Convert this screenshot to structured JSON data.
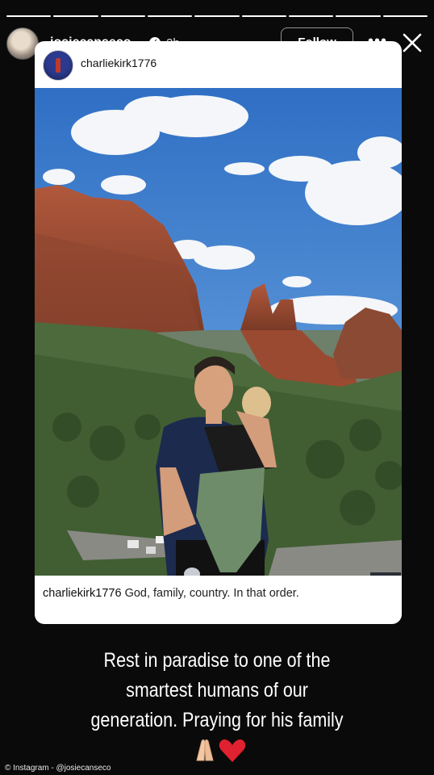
{
  "story": {
    "username": "josiecanseco",
    "age": "2h",
    "follow_label": "Follow",
    "more_label": "•••",
    "segments_total": 9,
    "segments_active": 9
  },
  "post": {
    "username": "charliekirk1776",
    "caption_user": "charliekirk1776",
    "caption_text": "God, family, country. In that order."
  },
  "message": {
    "line1": "Rest in paradise to one of the",
    "line2": "smartest humans of our",
    "line3": "generation. Praying for his family"
  },
  "emojis": [
    "praying-hands-icon",
    "red-heart-icon"
  ],
  "credit": "© Instagram - @josiecanseco",
  "colors": {
    "background": "#0a0a0a",
    "card": "#ffffff",
    "heart": "#e0212f"
  }
}
